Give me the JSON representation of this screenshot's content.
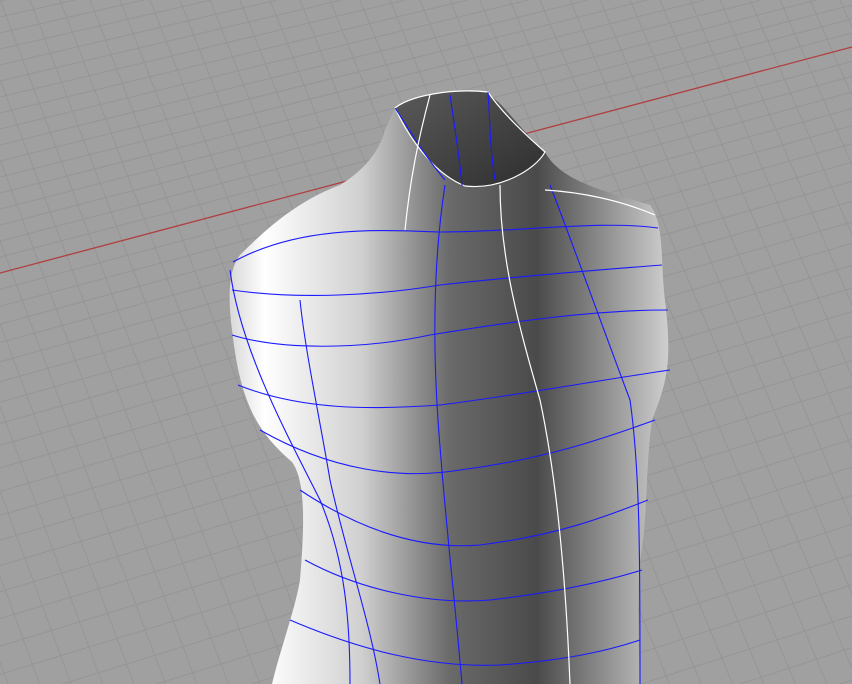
{
  "viewport": {
    "background_color": "#a0a0a0",
    "grid_color": "#959595",
    "x_axis_color": "#b04040",
    "isocurve_color": "#1a1aff",
    "seam_color": "#ffffff",
    "object": "mannequin-torso"
  }
}
